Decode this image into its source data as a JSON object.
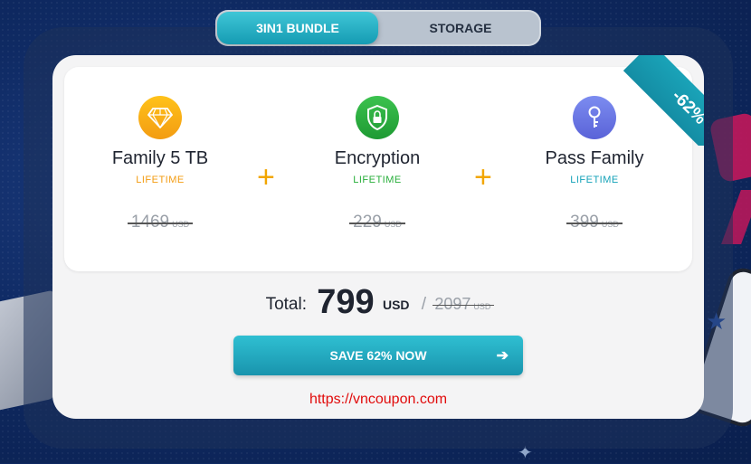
{
  "tabs": [
    {
      "label": "3IN1 BUNDLE",
      "active": true
    },
    {
      "label": "STORAGE",
      "active": false
    }
  ],
  "discount_badge": "-62%",
  "products": [
    {
      "name": "Family 5 TB",
      "term": "LIFETIME",
      "price": "1469",
      "currency": "USD",
      "icon": "diamond-icon",
      "color": "#f39c12"
    },
    {
      "name": "Encryption",
      "term": "LIFETIME",
      "price": "229",
      "currency": "USD",
      "icon": "shield-lock-icon",
      "color": "#27ae3a"
    },
    {
      "name": "Pass Family",
      "term": "LIFETIME",
      "price": "399",
      "currency": "USD",
      "icon": "key-icon",
      "color": "#14a2b8"
    }
  ],
  "total": {
    "label": "Total:",
    "value": "799",
    "currency": "USD",
    "old_value": "2097",
    "old_currency": "USD"
  },
  "cta": {
    "label": "SAVE 62% NOW",
    "icon": "arrow-right-icon"
  },
  "watermark": "https://vncoupon.com",
  "colors": {
    "accent": "#1aa3b8",
    "term_family": "#f39c12",
    "term_encryption": "#27ae3a",
    "term_pass": "#14a2b8"
  }
}
